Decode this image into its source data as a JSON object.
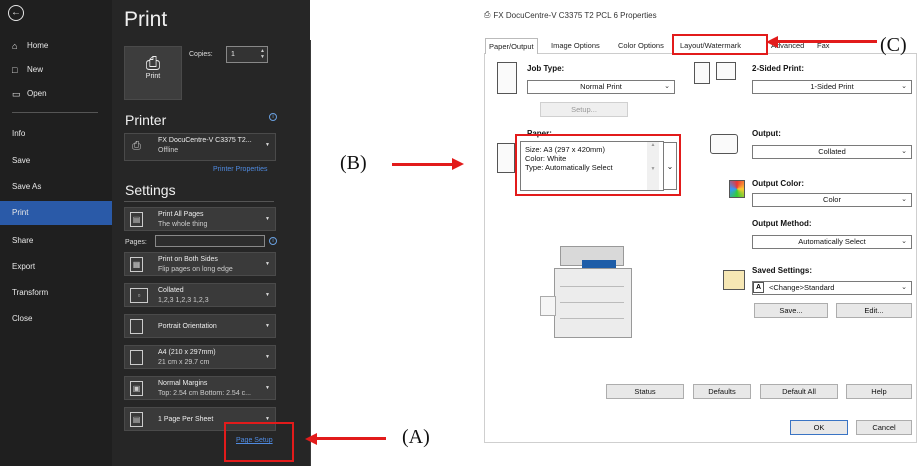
{
  "sidebar": {
    "back_symbol": "←",
    "items": [
      {
        "label": "Home",
        "icon": "home-icon"
      },
      {
        "label": "New",
        "icon": "new-file-icon"
      },
      {
        "label": "Open",
        "icon": "folder-icon"
      },
      {
        "label": "Info",
        "icon": ""
      },
      {
        "label": "Save",
        "icon": ""
      },
      {
        "label": "Save As",
        "icon": ""
      },
      {
        "label": "Print",
        "icon": ""
      },
      {
        "label": "Share",
        "icon": ""
      },
      {
        "label": "Export",
        "icon": ""
      },
      {
        "label": "Transform",
        "icon": ""
      },
      {
        "label": "Close",
        "icon": ""
      }
    ],
    "active_item": "Print"
  },
  "print_panel": {
    "title": "Print",
    "print_button_label": "Print",
    "copies_label": "Copies:",
    "copies_value": "1",
    "printer_section": "Printer",
    "printer_name": "FX DocuCentre-V C3375 T2...",
    "printer_status": "Offline",
    "printer_properties_link": "Printer Properties",
    "settings_section": "Settings",
    "settings": [
      {
        "line1": "Print All Pages",
        "line2": "The whole thing"
      },
      {
        "line1": "Print on Both Sides",
        "line2": "Flip pages on long edge"
      },
      {
        "line1": "Collated",
        "line2": "1,2,3   1,2,3   1,2,3"
      },
      {
        "line1": "Portrait Orientation",
        "line2": ""
      },
      {
        "line1": "A4 (210 x 297mm)",
        "line2": "21 cm x 29.7 cm"
      },
      {
        "line1": "Normal Margins",
        "line2": "Top: 2.54 cm Bottom: 2.54 c..."
      },
      {
        "line1": "1 Page Per Sheet",
        "line2": ""
      }
    ],
    "pages_label": "Pages:",
    "page_setup_link": "Page Setup"
  },
  "annotations": {
    "a": "(A)",
    "b": "(B)",
    "c": "(C)",
    "color": "#e21b1b"
  },
  "dialog": {
    "title": "FX DocuCentre-V C3375 T2 PCL 6 Properties",
    "tabs": [
      "Paper/Output",
      "Image Options",
      "Color Options",
      "Layout/Watermark",
      "Advanced",
      "Fax"
    ],
    "job_type_label": "Job Type:",
    "job_type_value": "Normal Print",
    "setup_button": "Setup...",
    "two_sided_label": "2-Sided Print:",
    "two_sided_value": "1-Sided Print",
    "paper_label": "Paper:",
    "paper_size": "Size: A3 (297 x 420mm)",
    "paper_color": "Color: White",
    "paper_type": "Type: Automatically Select",
    "output_label": "Output:",
    "output_value": "Collated",
    "output_color_label": "Output Color:",
    "output_color_value": "Color",
    "output_method_label": "Output Method:",
    "output_method_value": "Automatically Select",
    "saved_settings_label": "Saved Settings:",
    "saved_settings_value": "<Change>Standard",
    "saved_settings_icon_letter": "A",
    "save_button": "Save...",
    "edit_button": "Edit...",
    "status_button": "Status",
    "defaults_button": "Defaults",
    "default_all_button": "Default All",
    "help_button": "Help",
    "ok_button": "OK",
    "cancel_button": "Cancel"
  }
}
